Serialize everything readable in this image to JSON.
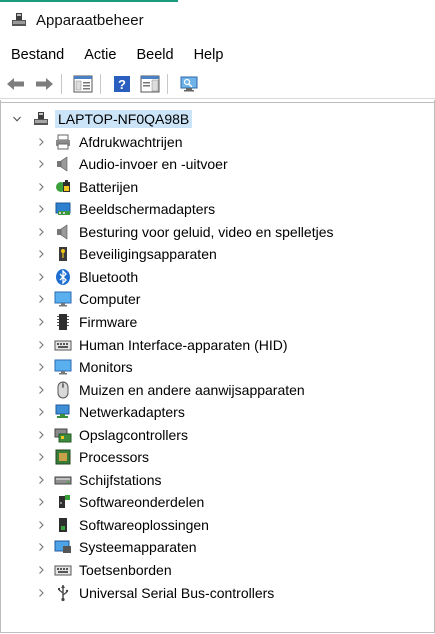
{
  "window": {
    "title": "Apparaatbeheer",
    "accent": "#1a9b7e"
  },
  "menu": [
    "Bestand",
    "Actie",
    "Beeld",
    "Help"
  ],
  "toolbar": [
    {
      "name": "back-button",
      "icon": "arrow-left-icon"
    },
    {
      "name": "forward-button",
      "icon": "arrow-right-icon"
    },
    {
      "name": "properties-view-button",
      "icon": "console-tree-icon"
    },
    {
      "name": "help-button",
      "icon": "help-icon"
    },
    {
      "name": "show-console-tree-button",
      "icon": "panel-icon"
    },
    {
      "name": "scan-hardware-button",
      "icon": "monitor-scan-icon"
    }
  ],
  "tree": {
    "root": {
      "label": "LAPTOP-NF0QA98B",
      "icon": "computer-tower-icon",
      "expanded": true
    },
    "items": [
      {
        "label": "Afdrukwachtrijen",
        "icon": "printer-icon"
      },
      {
        "label": "Audio-invoer en -uitvoer",
        "icon": "speaker-icon"
      },
      {
        "label": "Batterijen",
        "icon": "battery-icon"
      },
      {
        "label": "Beeldschermadapters",
        "icon": "display-adapter-icon"
      },
      {
        "label": "Besturing voor geluid, video en spelletjes",
        "icon": "speaker-icon"
      },
      {
        "label": "Beveiligingsapparaten",
        "icon": "key-icon"
      },
      {
        "label": "Bluetooth",
        "icon": "bluetooth-icon"
      },
      {
        "label": "Computer",
        "icon": "monitor-icon"
      },
      {
        "label": "Firmware",
        "icon": "chip-icon"
      },
      {
        "label": "Human Interface-apparaten (HID)",
        "icon": "keyboard-icon"
      },
      {
        "label": "Monitors",
        "icon": "monitor-icon"
      },
      {
        "label": "Muizen en andere aanwijsapparaten",
        "icon": "mouse-icon"
      },
      {
        "label": "Netwerkadapters",
        "icon": "network-icon"
      },
      {
        "label": "Opslagcontrollers",
        "icon": "storage-controller-icon"
      },
      {
        "label": "Processors",
        "icon": "processor-icon"
      },
      {
        "label": "Schijfstations",
        "icon": "disk-drive-icon"
      },
      {
        "label": "Softwareonderdelen",
        "icon": "software-component-icon"
      },
      {
        "label": "Softwareoplossingen",
        "icon": "software-device-icon"
      },
      {
        "label": "Systeemapparaten",
        "icon": "system-device-icon"
      },
      {
        "label": "Toetsenborden",
        "icon": "keyboard-icon"
      },
      {
        "label": "Universal Serial Bus-controllers",
        "icon": "usb-icon"
      }
    ]
  }
}
